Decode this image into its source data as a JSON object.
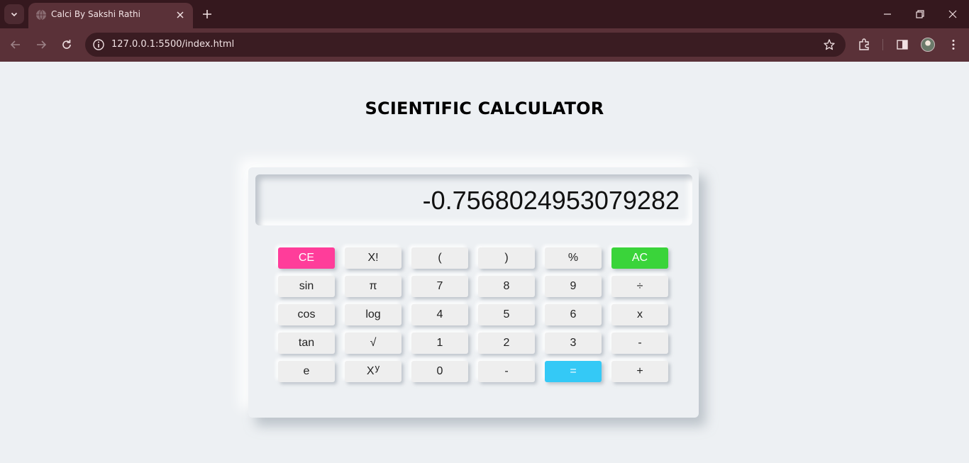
{
  "browser": {
    "tab_title": "Calci By Sakshi Rathi",
    "url": "127.0.0.1:5500/index.html"
  },
  "page": {
    "title": "SCIENTIFIC CALCULATOR"
  },
  "calculator": {
    "display_value": "-0.7568024953079282",
    "keys": {
      "ce": "CE",
      "factorial": "X!",
      "open_paren": "(",
      "close_paren": ")",
      "percent": "%",
      "ac": "AC",
      "sin": "sin",
      "pi": "π",
      "seven": "7",
      "eight": "8",
      "nine": "9",
      "divide": "÷",
      "cos": "cos",
      "log": "log",
      "four": "4",
      "five": "5",
      "six": "6",
      "multiply": "x",
      "tan": "tan",
      "sqrt": "√",
      "one": "1",
      "two": "2",
      "three": "3",
      "minus": "-",
      "e": "e",
      "power_base": "X",
      "power_exp": "y",
      "zero": "0",
      "dash": "-",
      "equals": "=",
      "plus": "+"
    }
  },
  "colors": {
    "ce": "#ff3d9a",
    "ac": "#3ad43a",
    "equals": "#34c9f6",
    "background": "#edf0f3"
  }
}
